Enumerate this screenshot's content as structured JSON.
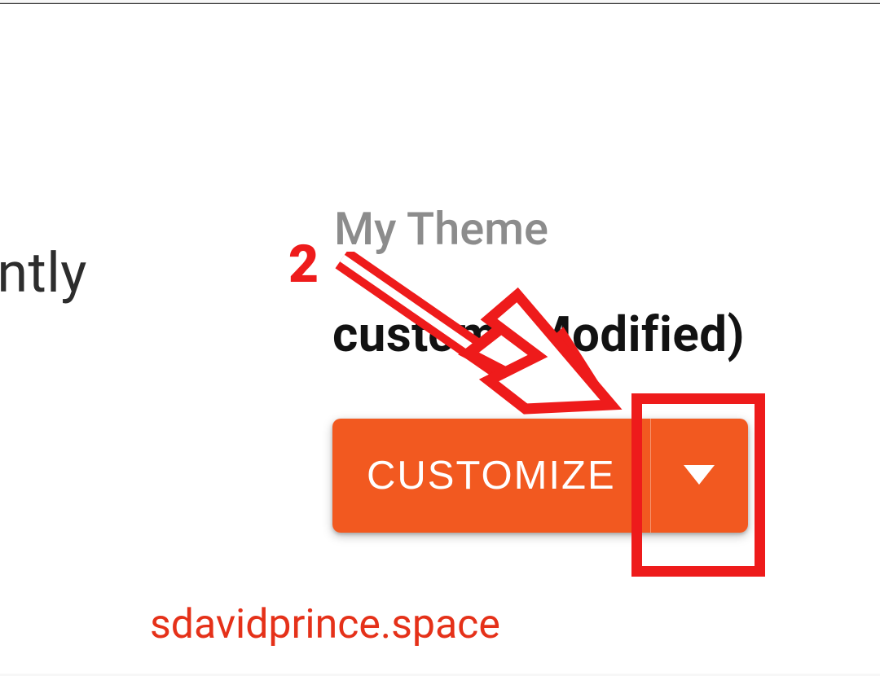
{
  "sidebar": {
    "partial_text": "rently"
  },
  "theme": {
    "title": "My Theme",
    "name": "custom (Modified)"
  },
  "buttons": {
    "customize_label": "CUSTOMIZE"
  },
  "annotation": {
    "step_number": "2",
    "watermark": "sdavidprince.space"
  },
  "colors": {
    "accent": "#f25920",
    "annotation": "#ee1b1b"
  }
}
